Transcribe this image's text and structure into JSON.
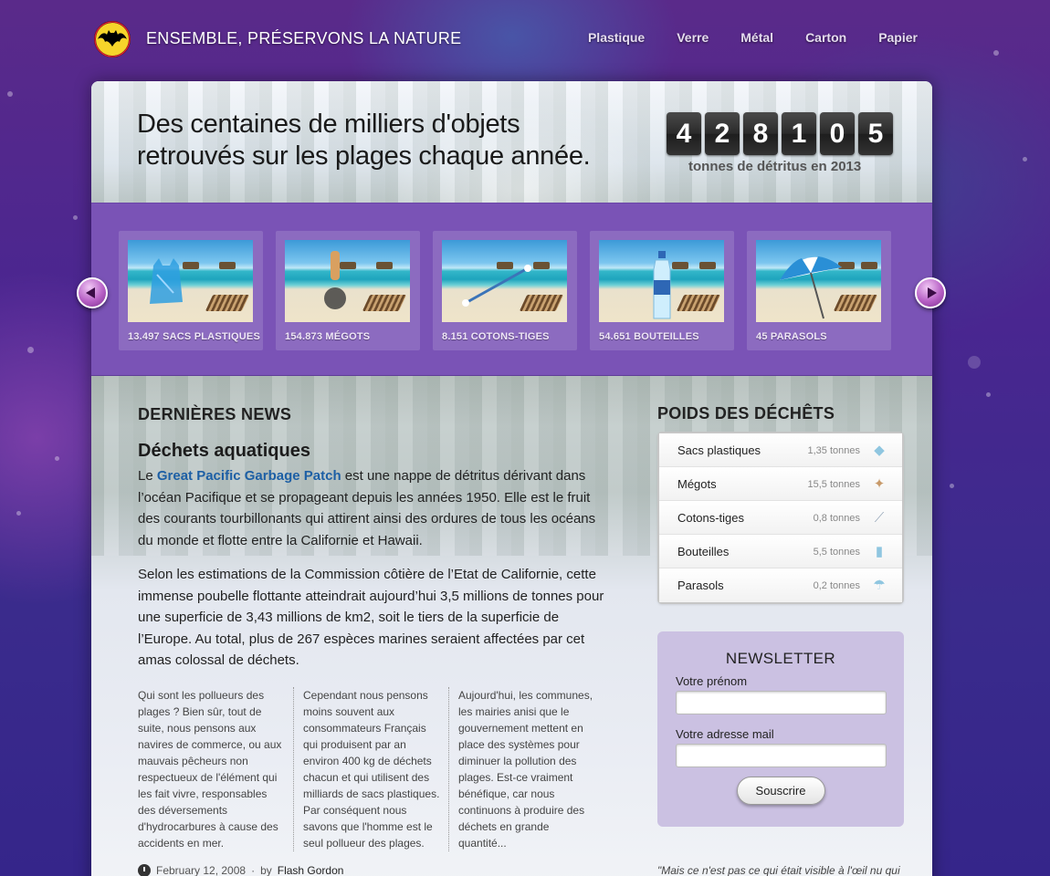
{
  "header": {
    "site_title": "ENSEMBLE, PRÉSERVONS LA NATURE",
    "nav": [
      "Plastique",
      "Verre",
      "Métal",
      "Carton",
      "Papier"
    ]
  },
  "hero": {
    "headline_line1": "Des centaines de milliers d'objets",
    "headline_line2": "retrouvés sur les plages chaque année.",
    "counter_digits": [
      "4",
      "2",
      "8",
      "1",
      "0",
      "5"
    ],
    "counter_label": "tonnes de détritus en 2013"
  },
  "carousel": {
    "items": [
      {
        "caption": "13.497 SACS PLASTIQUES"
      },
      {
        "caption": "154.873 MÉGOTS"
      },
      {
        "caption": "8.151 COTONS-TIGES"
      },
      {
        "caption": "54.651 BOUTEILLES"
      },
      {
        "caption": "45 PARASOLS"
      }
    ]
  },
  "news": {
    "section_title": "DERNIÈRES NEWS",
    "article_title": "Déchets aquatiques",
    "para1_before": "Le ",
    "para1_link": "Great Pacific Garbage Patch",
    "para1_after": " est une nappe de détritus dérivant dans l’océan Pacifique et se propageant depuis les années 1950. Elle est le fruit des courants tourbillonants qui attirent ainsi des ordures de tous les océans du monde et flotte entre la Californie et Hawaii.",
    "para2": "Selon les estimations de la Commission côtière de l’Etat de Californie, cette immense poubelle flottante atteindrait aujourd’hui 3,5 millions de tonnes pour une superficie de 3,43 millions de km2, soit le tiers de la superficie de l’Europe. Au total, plus de 267 espèces marines seraient affectées par cet amas colossal de déchets.",
    "columns": [
      "Qui sont les pollueurs des plages ? Bien sûr, tout de suite, nous pensons aux navires de commerce, ou aux mauvais pêcheurs non respectueux de l'élément qui les fait vivre, responsables des déversements d'hydrocarbures à cause des accidents en mer.",
      "Cependant nous pensons moins souvent aux consommateurs Français qui produisent par an environ 400 kg de déchets chacun et qui utilisent des milliards de sacs plastiques. Par conséquent nous savons que l'homme est le seul pollueur des plages.",
      "Aujourd'hui, les communes, les mairies anisi que le gouvernement mettent en place des systèmes pour diminuer la pollution des plages. Est-ce vraiment bénéfique, car nous continuons à produire des déchets en grande quantité..."
    ],
    "date": "February 12, 2008",
    "by": "by",
    "author": "Flash Gordon"
  },
  "sidebar": {
    "weights_title": "POIDS DES DÉCHÊTS",
    "weights": [
      {
        "label": "Sacs plastiques",
        "value": "1,35 tonnes",
        "icon": "bag-icon"
      },
      {
        "label": "Mégots",
        "value": "15,5 tonnes",
        "icon": "cigarette-icon"
      },
      {
        "label": "Cotons-tiges",
        "value": "0,8 tonnes",
        "icon": "cotton-swab-icon"
      },
      {
        "label": "Bouteilles",
        "value": "5,5 tonnes",
        "icon": "bottle-icon"
      },
      {
        "label": "Parasols",
        "value": "0,2 tonnes",
        "icon": "umbrella-icon"
      }
    ],
    "newsletter": {
      "title": "NEWSLETTER",
      "first_name_label": "Votre prénom",
      "email_label": "Votre adresse mail",
      "submit_label": "Souscrire"
    },
    "quote": "\"Mais ce n'est pas ce qui était visible à l'œil nu qui était le plus impressionnant à l'intérieur et"
  },
  "colors": {
    "accent_purple": "#7a53b6",
    "link_blue": "#1d5fa5",
    "newsletter_bg": "#cbc1e2"
  }
}
